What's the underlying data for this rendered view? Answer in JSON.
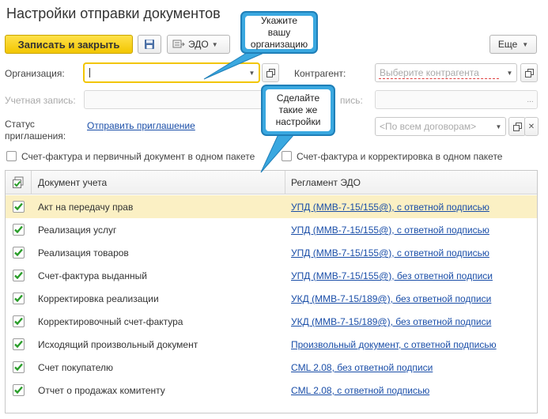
{
  "window": {
    "title": "Настройки отправки документов"
  },
  "toolbar": {
    "save_close_label": "Записать и закрыть",
    "edo_label": "ЭДО",
    "more_label": "Еще"
  },
  "form": {
    "organization_label": "Организация:",
    "organization_value": "",
    "account_label": "Учетная запись:",
    "counterparty_label": "Контрагент:",
    "counterparty_placeholder": "Выберите контрагента",
    "contract_label_partial": "пись:",
    "contract_placeholder": "<По всем договорам>",
    "status_label": "Статус\nприглашения:",
    "invite_link": "Отправить приглашение",
    "checkbox_invoice_primary": "Счет-фактура и первичный документ в одном пакете",
    "checkbox_invoice_correction": "Счет-фактура и корректировка в одном пакете"
  },
  "callouts": {
    "organization": "Укажите\nвашу\nорганизацию",
    "settings": "Сделайте\nтакие же\nнастройки"
  },
  "table": {
    "columns": [
      "Документ учета",
      "Регламент ЭДО"
    ],
    "rows": [
      {
        "doc": "Акт на передачу прав",
        "rule": "УПД (ММВ-7-15/155@), с ответной подписью",
        "checked": true
      },
      {
        "doc": "Реализация услуг",
        "rule": "УПД (ММВ-7-15/155@), с ответной подписью",
        "checked": true
      },
      {
        "doc": "Реализация товаров",
        "rule": "УПД (ММВ-7-15/155@), с ответной подписью",
        "checked": true
      },
      {
        "doc": "Счет-фактура выданный",
        "rule": "УПД (ММВ-7-15/155@), без ответной подписи",
        "checked": true
      },
      {
        "doc": "Корректировка реализации",
        "rule": "УКД (ММВ-7-15/189@), без ответной подписи",
        "checked": true
      },
      {
        "doc": "Корректировочный счет-фактура",
        "rule": "УКД (ММВ-7-15/189@), без ответной подписи",
        "checked": true
      },
      {
        "doc": "Исходящий произвольный документ",
        "rule": "Произвольный документ, с ответной подписью",
        "checked": true
      },
      {
        "doc": "Счет покупателю",
        "rule": "CML 2.08, без ответной подписи",
        "checked": true
      },
      {
        "doc": "Отчет о продажах комитенту",
        "rule": "CML 2.08, с ответной подписью",
        "checked": true
      }
    ]
  },
  "colors": {
    "accent_yellow": "#f2c600",
    "link_blue": "#1a4ea8",
    "check_green": "#2a9d2a",
    "callout_blue": "#3aa8e0",
    "selected_row": "#fbf0c4"
  }
}
